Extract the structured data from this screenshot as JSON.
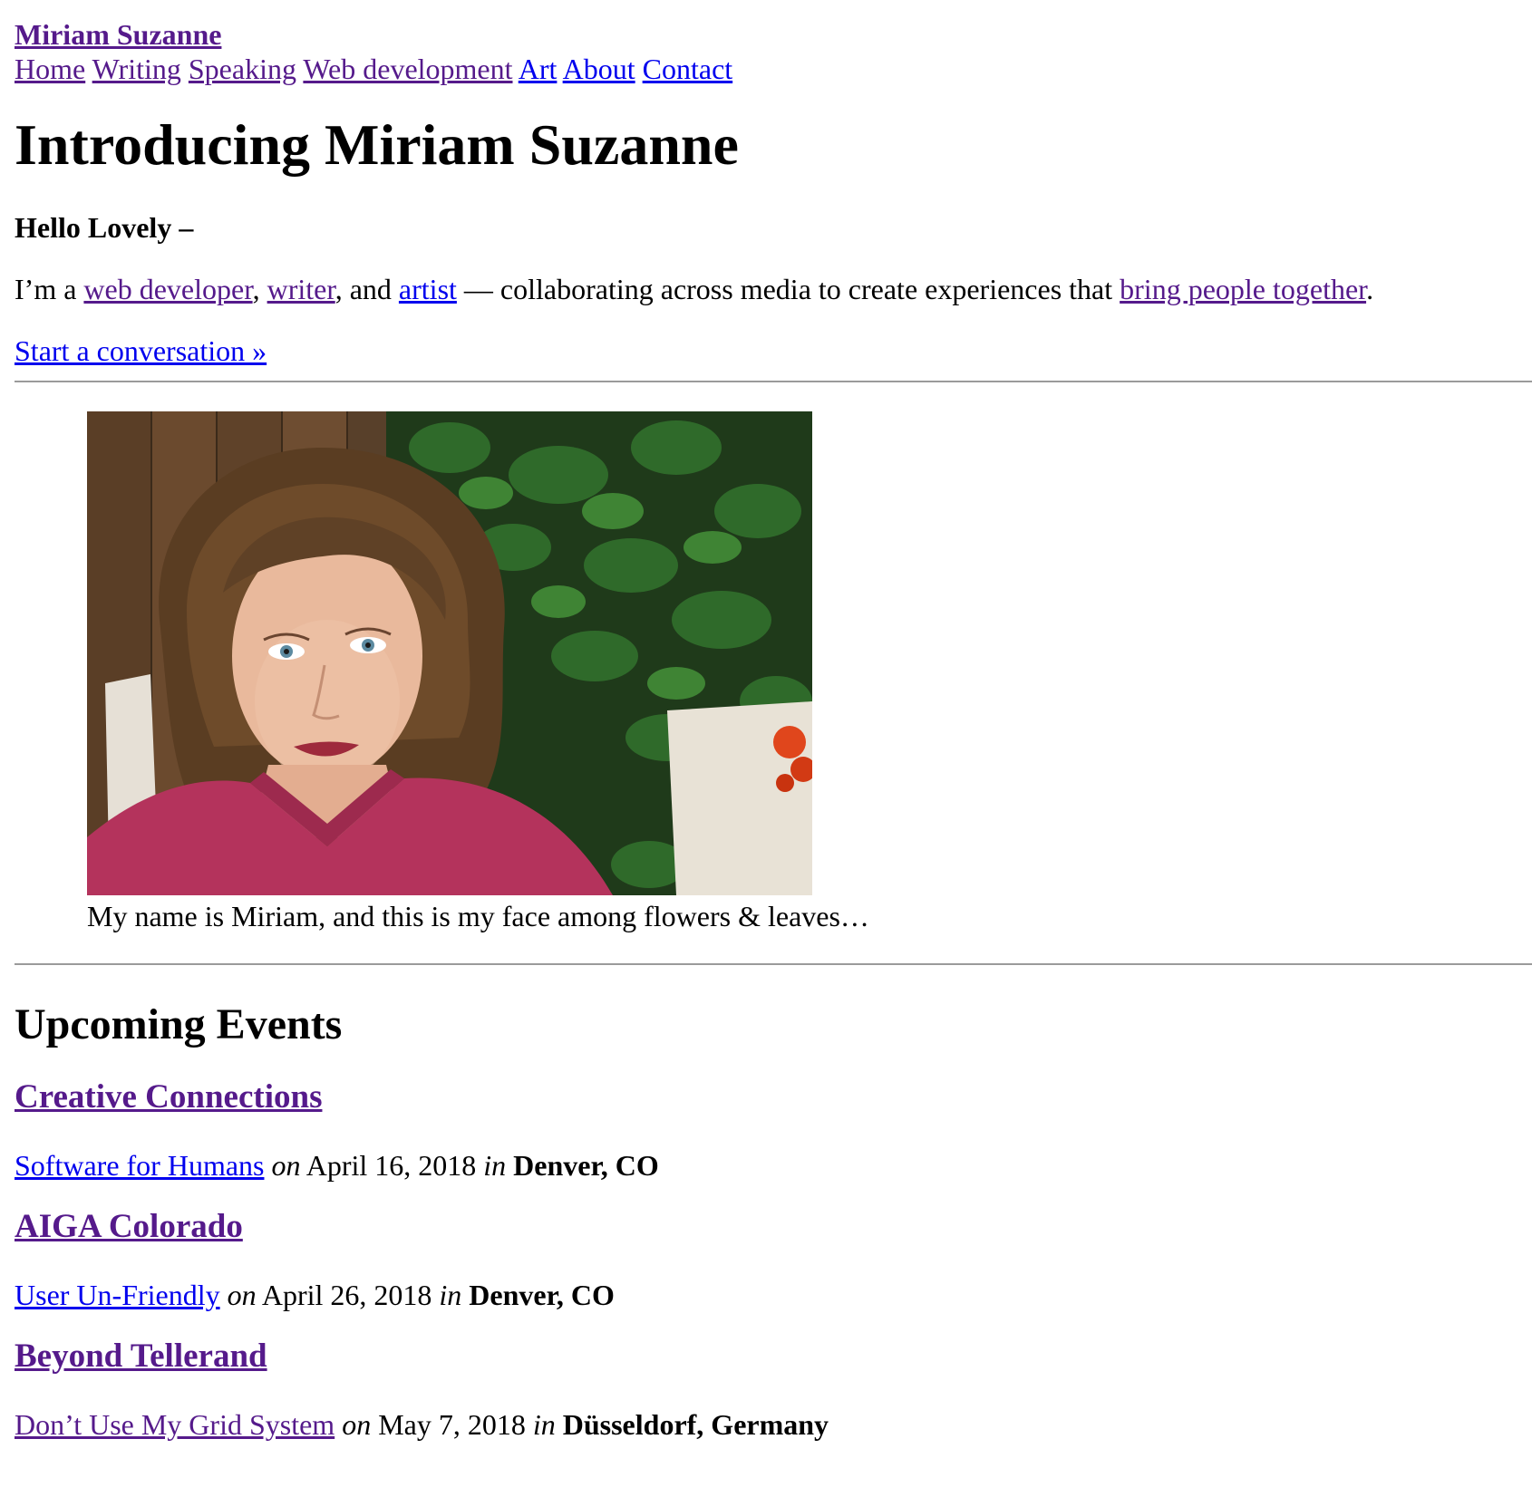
{
  "header": {
    "site_title": "Miriam Suzanne",
    "nav": [
      {
        "label": "Home"
      },
      {
        "label": "Writing"
      },
      {
        "label": "Speaking"
      },
      {
        "label": "Web development"
      },
      {
        "label": "Art"
      },
      {
        "label": "About"
      },
      {
        "label": "Contact"
      }
    ]
  },
  "main": {
    "title": "Introducing Miriam Suzanne",
    "greeting": "Hello Lovely –",
    "intro": {
      "prefix": "I’m a ",
      "link_web_developer": "web developer",
      "comma1": ", ",
      "link_writer": "writer",
      "and_text": ", and ",
      "link_artist": "artist",
      "middle": " — collaborating across media to create experiences that ",
      "link_bring_people": "bring people together",
      "suffix": "."
    },
    "cta": "Start a conversation »",
    "figure": {
      "caption": "My name is Miriam, and this is my face among flowers & leaves…"
    }
  },
  "events": {
    "heading": "Upcoming Events",
    "on_word": "on",
    "in_word": "in",
    "items": [
      {
        "event": "Creative Connections",
        "talk": "Software for Humans",
        "date": "April 16, 2018",
        "location": "Denver, CO"
      },
      {
        "event": "AIGA Colorado",
        "talk": "User Un-Friendly",
        "date": "April 26, 2018",
        "location": "Denver, CO"
      },
      {
        "event": "Beyond Tellerand",
        "talk": "Don’t Use My Grid System",
        "date": "May 7, 2018",
        "location": "Düsseldorf, Germany"
      }
    ]
  },
  "colors": {
    "link_visited": "#551a8b",
    "link_unvisited": "#0000ee",
    "rule": "#9a9a9a"
  }
}
